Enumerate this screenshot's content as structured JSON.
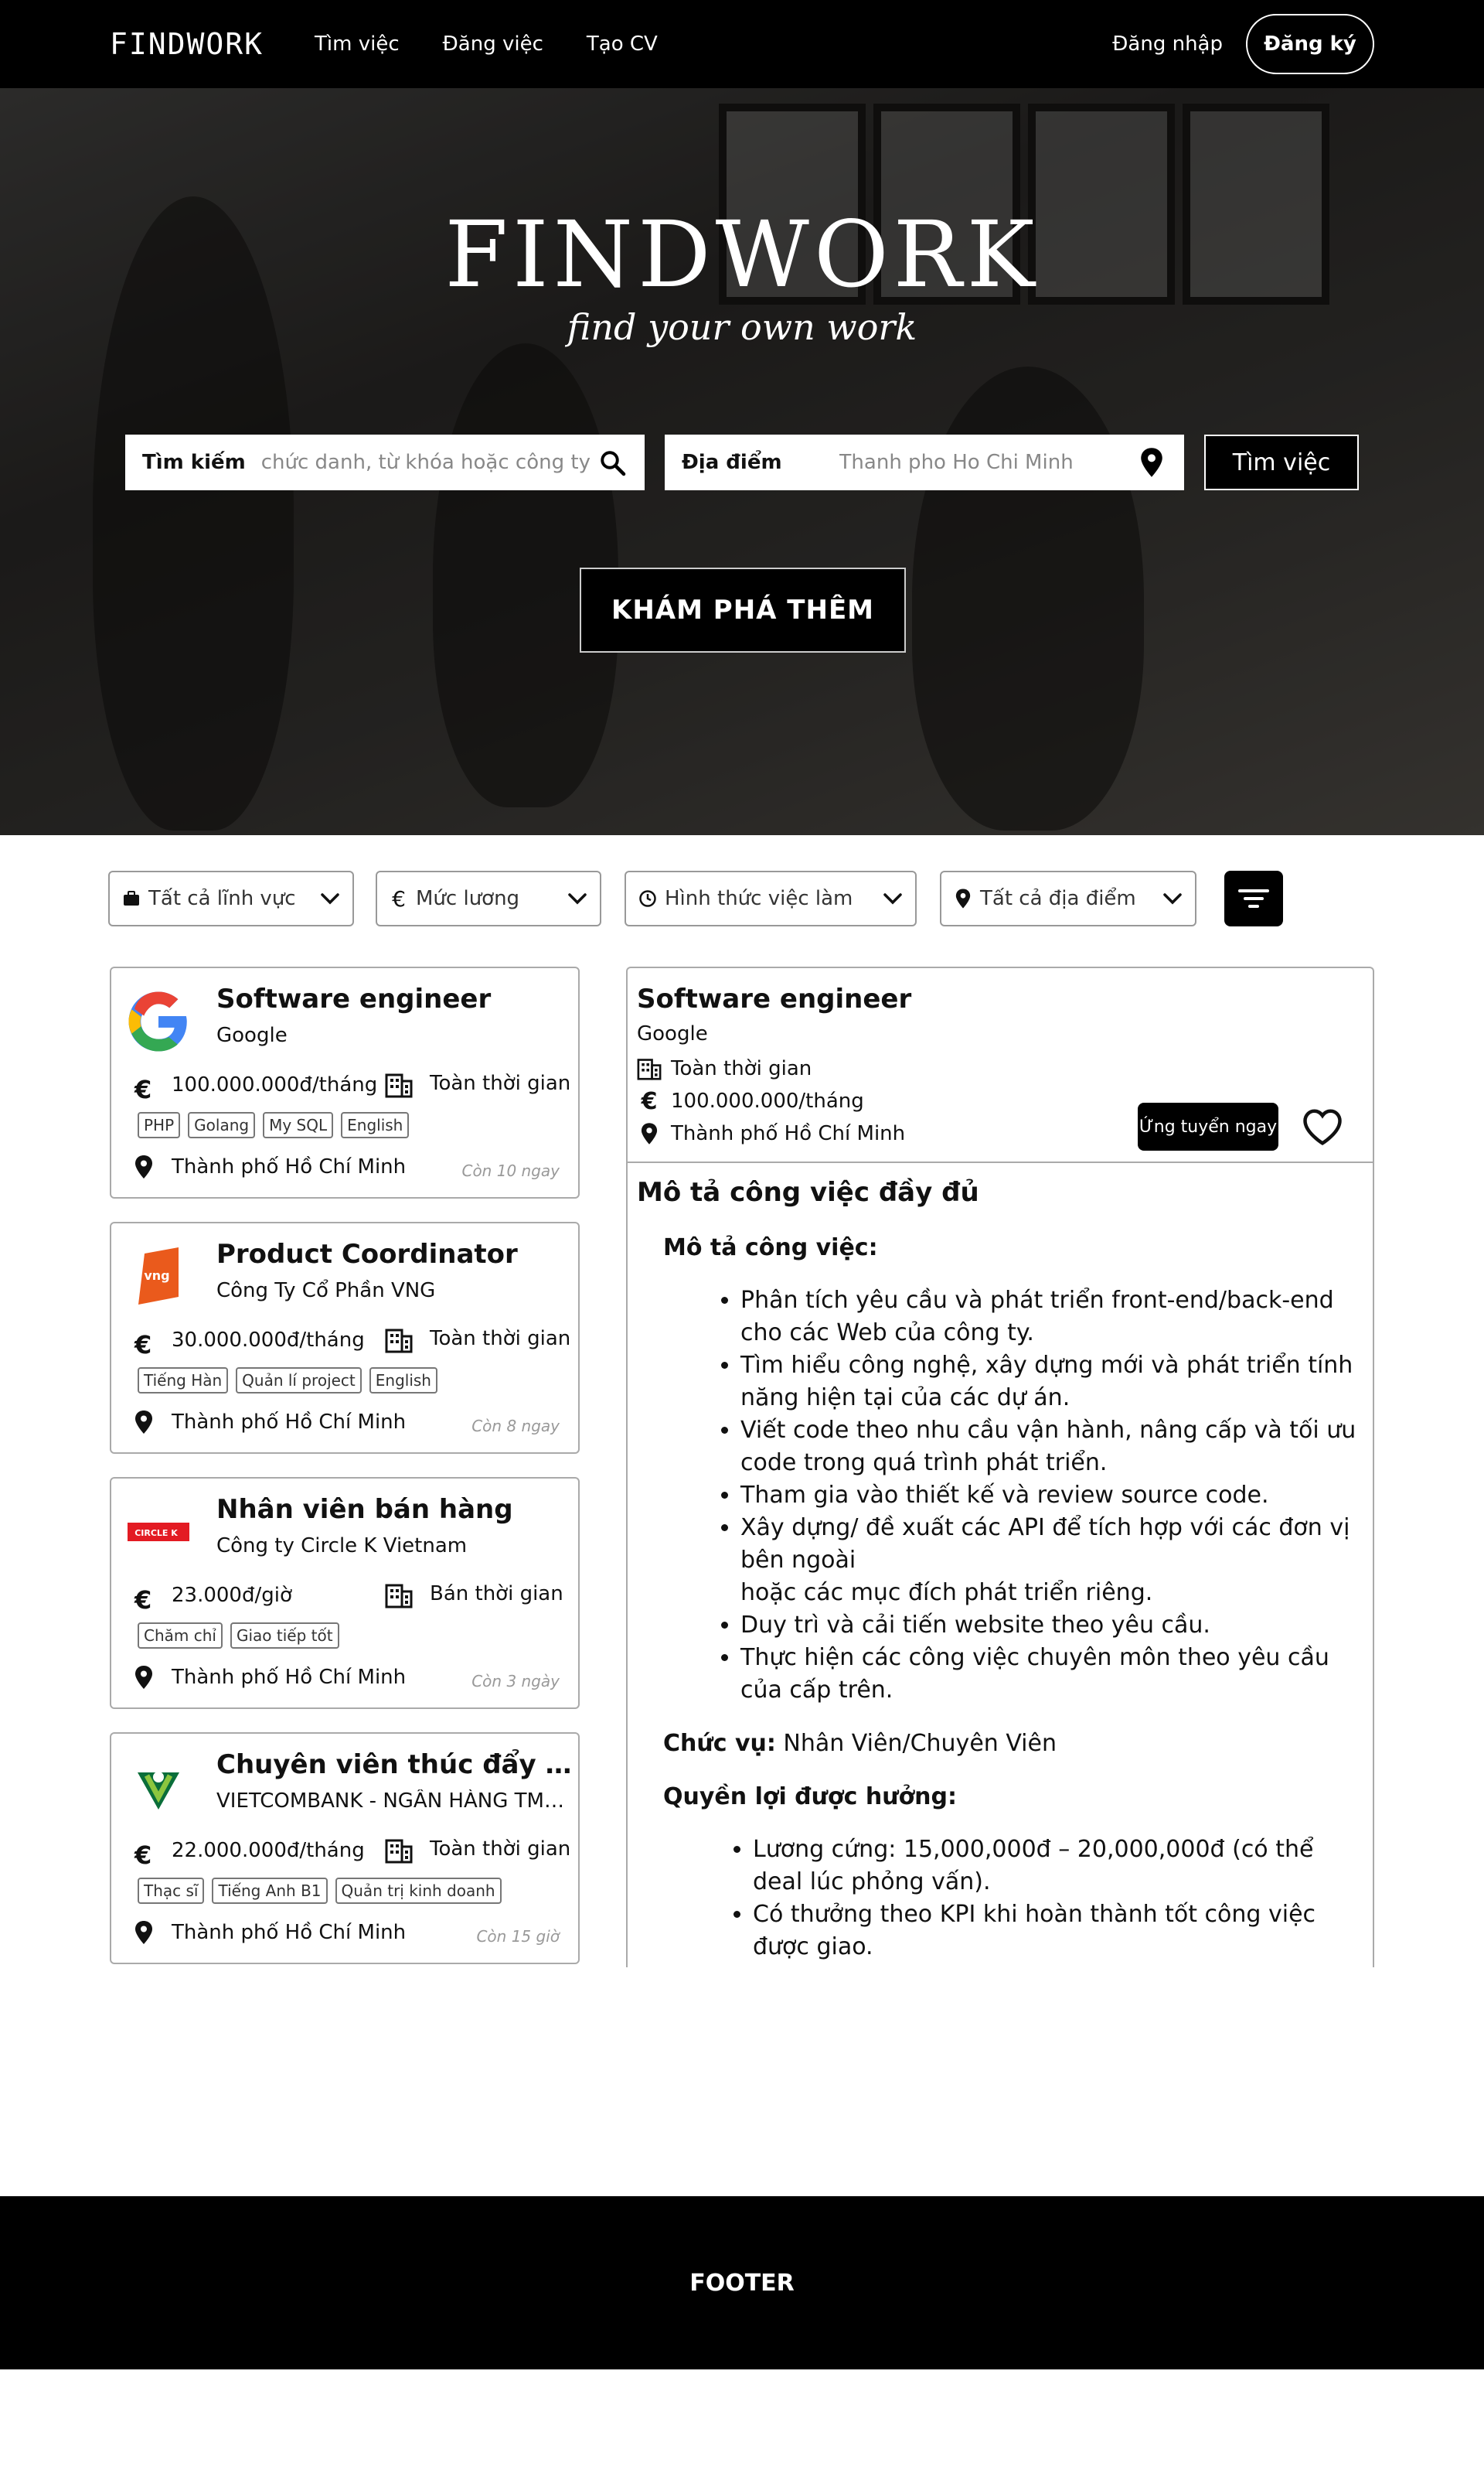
{
  "nav": {
    "brand": "FINDWORK",
    "links": [
      "Tìm việc",
      "Đăng việc",
      "Tạo CV"
    ],
    "login": "Đăng nhập",
    "signup": "Đăng ký"
  },
  "hero": {
    "title": "FINDWORK",
    "subtitle": "find your own work",
    "search_label": "Tìm kiếm",
    "search_placeholder": "chức danh, từ khóa hoặc công ty",
    "location_label": "Địa điểm",
    "location_placeholder": "Thanh pho Ho Chi Minh",
    "search_button": "Tìm việc",
    "explore_button": "KHÁM PHÁ THÊM"
  },
  "filters": {
    "field": "Tất cả lĩnh vực",
    "salary": "Mức lương",
    "work_type": "Hình thức việc làm",
    "location": "Tất cả địa điểm"
  },
  "jobs": [
    {
      "title": "Software engineer",
      "company": "Google",
      "salary": "100.000.000đ/tháng",
      "type": "Toàn thời gian",
      "tags": [
        "PHP",
        "Golang",
        "My SQL",
        "English"
      ],
      "location": "Thành phố Hồ Chí Minh",
      "time_left": "Còn 10 ngay"
    },
    {
      "title": "Product Coordinator",
      "company": "Công Ty Cổ Phần VNG",
      "salary": "30.000.000đ/tháng",
      "type": "Toàn thời gian",
      "tags": [
        "Tiếng Hàn",
        "Quản lí project",
        "English"
      ],
      "location": "Thành phố Hồ Chí Minh",
      "time_left": "Còn 8 ngay"
    },
    {
      "title": "Nhân viên bán hàng",
      "company": "Công ty Circle K Vietnam",
      "salary": "23.000đ/giờ",
      "type": "Bán thời gian",
      "tags": [
        "Chăm chỉ",
        "Giao tiếp tốt"
      ],
      "location": "Thành phố Hồ Chí Minh",
      "time_left": "Còn 3 ngày"
    },
    {
      "title": "Chuyên viên thúc đẩy nâ...",
      "company": "VIETCOMBANK - NGÂN HÀNG TMCP ...",
      "salary": "22.000.000đ/tháng",
      "type": "Toàn thời gian",
      "tags": [
        "Thạc sĩ",
        "Tiếng Anh B1",
        "Quản trị kinh doanh"
      ],
      "location": "Thành phố Hồ Chí Minh",
      "time_left": "Còn 15 giờ"
    }
  ],
  "logos": {
    "vng": "vng",
    "circlek": "CIRCLE K"
  },
  "detail": {
    "title": "Software engineer",
    "company": "Google",
    "type": "Toàn thời gian",
    "salary": "100.000.000/tháng",
    "location": "Thành phố Hồ Chí Minh",
    "apply": "Ứng tuyển ngay",
    "section_title": "Mô tả công việc đầy đủ",
    "desc_heading": "Mô tả công việc:",
    "desc_items": [
      "Phân tích yêu cầu và phát triển front-end/back-end cho các Web của công ty.",
      "Tìm hiểu công nghệ, xây dựng mới và phát triển tính năng hiện tại của các dự án.",
      "Viết code theo nhu cầu vận hành, nâng cấp và tối ưu code trong quá trình phát triển.",
      "Tham gia vào thiết kế và review source code.",
      "Xây dựng/ đề xuất các API để tích hợp với các đơn vị bên ngoài",
      "hoặc các mục đích phát triển riêng.",
      "Duy trì và cải tiến website theo yêu cầu.",
      "Thực hiện các công việc chuyên môn theo yêu cầu của cấp trên."
    ],
    "position_label": "Chức vụ:",
    "position_value": "Nhân Viên/Chuyên Viên",
    "benefits_heading": "Quyền lợi được hưởng:",
    "benefit_items": [
      "Lương cứng: 15,000,000đ – 20,000,000đ (có thể deal lúc phỏng vấn).",
      "Có thưởng theo KPI khi hoàn thành tốt công việc được giao."
    ]
  },
  "footer": {
    "label": "FOOTER"
  }
}
